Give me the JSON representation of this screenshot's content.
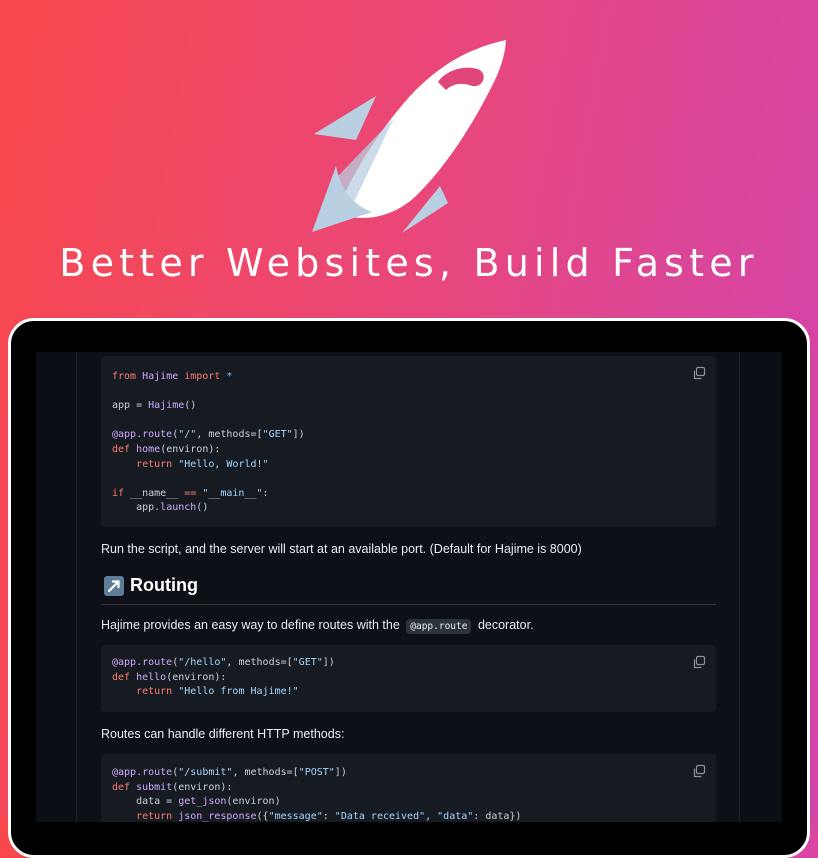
{
  "hero": {
    "title": "Better Websites, Build Faster"
  },
  "doc": {
    "code1": [
      [
        [
          "from ",
          "kw"
        ],
        [
          "Hajime ",
          "fn"
        ],
        [
          "import ",
          "kw"
        ],
        [
          "*",
          "op"
        ]
      ],
      [],
      [
        [
          "app = ",
          ""
        ],
        [
          "Hajime",
          "fn"
        ],
        [
          "()",
          ""
        ]
      ],
      [],
      [
        [
          "@app.route",
          "fn"
        ],
        [
          "(",
          ""
        ],
        [
          "\"/\"",
          "st"
        ],
        [
          ", methods=[",
          ""
        ],
        [
          "\"GET\"",
          "st"
        ],
        [
          "])",
          ""
        ]
      ],
      [
        [
          "def ",
          "kw"
        ],
        [
          "home",
          "fn"
        ],
        [
          "(environ):",
          ""
        ]
      ],
      [
        [
          "    return ",
          "kw"
        ],
        [
          "\"Hello, World!\"",
          "st"
        ]
      ],
      [],
      [
        [
          "if ",
          "kw"
        ],
        [
          "__name__ ",
          ""
        ],
        [
          "== ",
          "kw"
        ],
        [
          "\"__main__\"",
          "st"
        ],
        [
          ":",
          ""
        ]
      ],
      [
        [
          "    app.",
          ""
        ],
        [
          "launch",
          "fn"
        ],
        [
          "()",
          ""
        ]
      ]
    ],
    "run_text": "Run the script, and the server will start at an available port. (Default for Hajime is 8000)",
    "routing_heading": "Routing",
    "routes_intro_before": "Hajime provides an easy way to define routes with the",
    "routes_intro_code": "@app.route",
    "routes_intro_after": "decorator.",
    "code2": [
      [
        [
          "@app.route",
          "fn"
        ],
        [
          "(",
          ""
        ],
        [
          "\"/hello\"",
          "st"
        ],
        [
          ", methods=[",
          ""
        ],
        [
          "\"GET\"",
          "st"
        ],
        [
          "])",
          ""
        ]
      ],
      [
        [
          "def ",
          "kw"
        ],
        [
          "hello",
          "fn"
        ],
        [
          "(environ):",
          ""
        ]
      ],
      [
        [
          "    return ",
          "kw"
        ],
        [
          "\"Hello from Hajime!\"",
          "st"
        ]
      ]
    ],
    "methods_text": "Routes can handle different HTTP methods:",
    "code3": [
      [
        [
          "@app.route",
          "fn"
        ],
        [
          "(",
          ""
        ],
        [
          "\"/submit\"",
          "st"
        ],
        [
          ", methods=[",
          ""
        ],
        [
          "\"POST\"",
          "st"
        ],
        [
          "])",
          ""
        ]
      ],
      [
        [
          "def ",
          "kw"
        ],
        [
          "submit",
          "fn"
        ],
        [
          "(environ):",
          ""
        ]
      ],
      [
        [
          "    data = ",
          ""
        ],
        [
          "get_json",
          "fn"
        ],
        [
          "(environ)",
          ""
        ]
      ],
      [
        [
          "    return ",
          "kw"
        ],
        [
          "json_response",
          "fn"
        ],
        [
          "({",
          ""
        ],
        [
          "\"message\"",
          "st"
        ],
        [
          ": ",
          ""
        ],
        [
          "\"Data received\"",
          "st"
        ],
        [
          ", ",
          ""
        ],
        [
          "\"data\"",
          "st"
        ],
        [
          ": data})",
          ""
        ]
      ]
    ]
  }
}
